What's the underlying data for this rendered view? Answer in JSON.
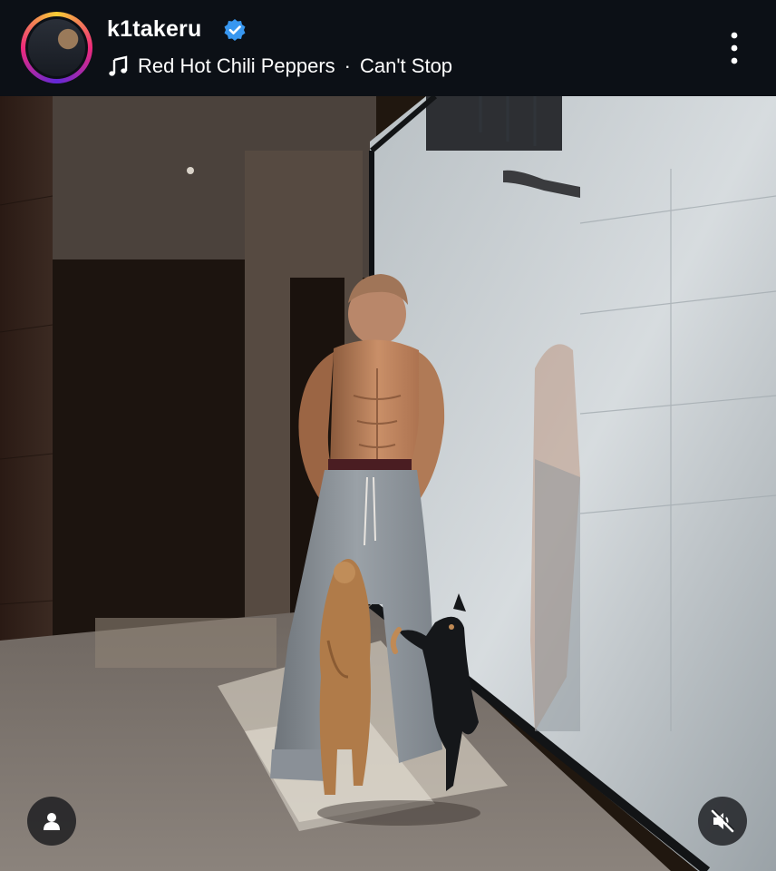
{
  "post": {
    "username": "k1takeru",
    "verified": true,
    "music": {
      "artist": "Red Hot Chili Peppers",
      "separator": "·",
      "song": "Can't Stop"
    },
    "icons": {
      "verified": "verified-badge-icon",
      "music": "music-note-icon",
      "more": "more-options-icon",
      "user_tag": "user-tag-icon",
      "mute": "muted-audio-icon"
    }
  },
  "colors": {
    "header_bg": "#0c1016",
    "verified_blue": "#3897f0",
    "text": "#ffffff"
  }
}
